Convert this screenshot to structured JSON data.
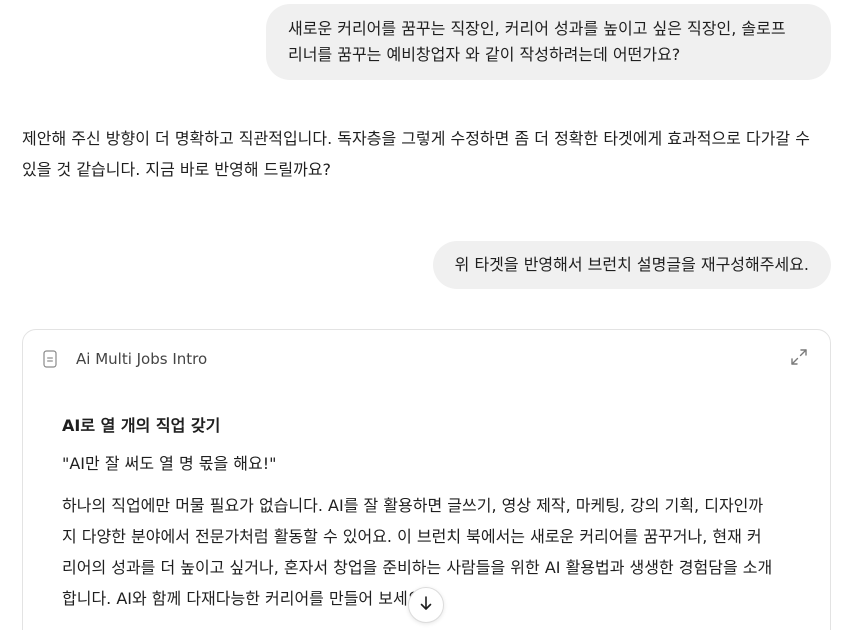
{
  "messages": {
    "user_1": "새로운 커리어를 꿈꾸는 직장인, 커리어 성과를 높이고 싶은 직장인, 솔로프\n리너를 꿈꾸는 예비창업자 와 같이 작성하려는데 어떤가요?",
    "assistant_1": "제안해 주신 방향이 더 명확하고 직관적입니다. 독자층을 그렇게 수정하면 좀 더 정확한 타겟에게 효과적으로 다가갈 수\n있을 것 같습니다. 지금 바로 반영해 드릴까요?",
    "user_2": "위 타겟을 반영해서 브런치 설명글을 재구성해주세요."
  },
  "document": {
    "icon": "document-icon",
    "title": "Ai Multi Jobs Intro",
    "expand_icon": "expand-icon",
    "heading": "AI로 열 개의 직업 갖기",
    "quote": "\"AI만 잘 써도 열 명 몫을 해요!\"",
    "paragraph": "하나의 직업에만 머물 필요가 없습니다. AI를 잘 활용하면 글쓰기, 영상 제작, 마케팅, 강의 기획, 디자인까\n지 다양한 분야에서 전문가처럼 활동할 수 있어요. 이 브런치 북에서는 새로운 커리어를 꿈꾸거나, 현재 커\n리어의 성과를 더 높이고 싶거나, 혼자서 창업을 준비하는 사람들을 위한 AI 활용법과 생생한 경험담을 소개\n합니다. AI와 함께 다재다능한 커리어를 만들어 보세요"
  },
  "controls": {
    "scroll_down_icon": "arrow-down-icon"
  }
}
